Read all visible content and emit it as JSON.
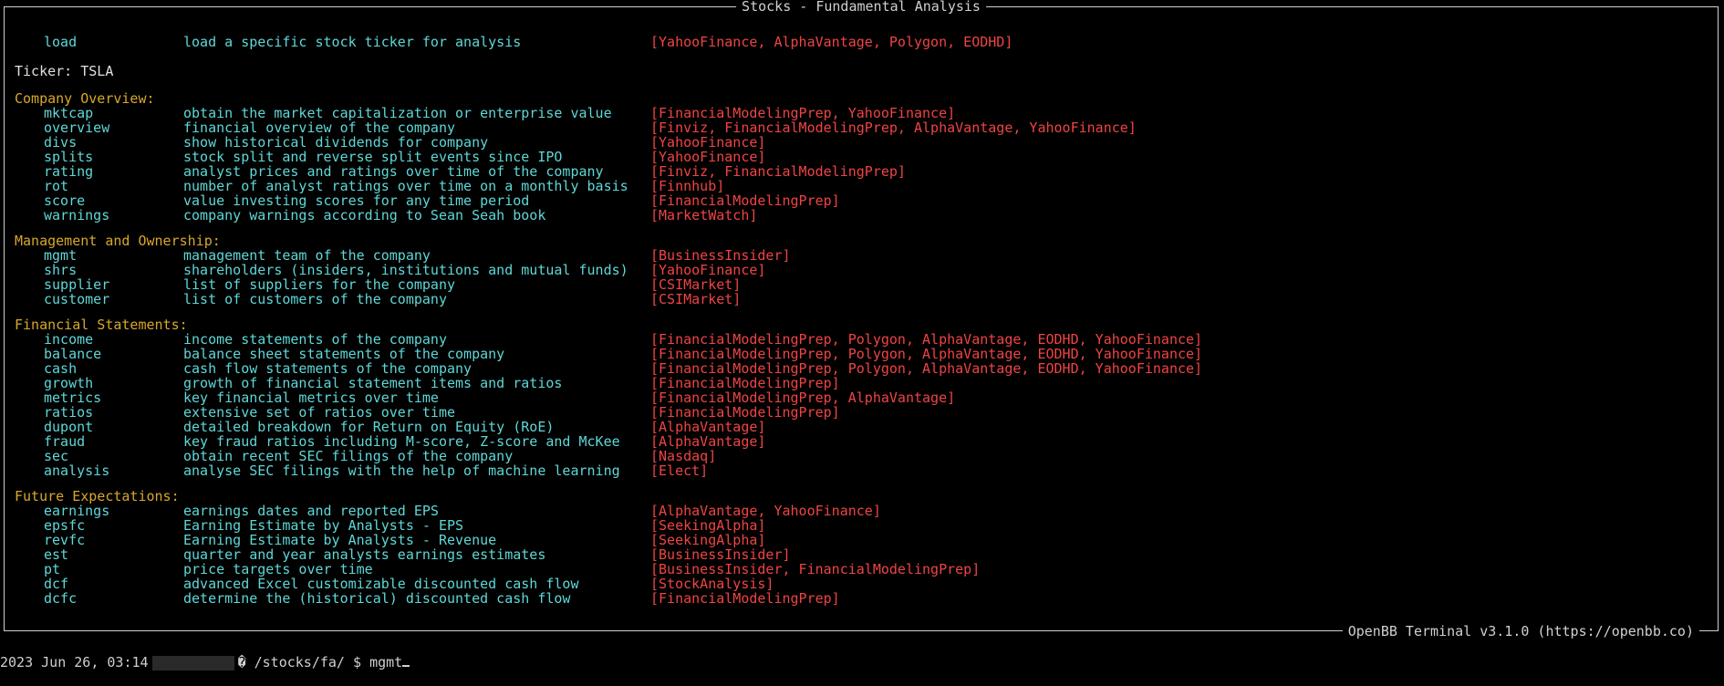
{
  "window": {
    "title": "Stocks - Fundamental Analysis",
    "footer": "OpenBB Terminal v3.1.0 (https://openbb.co)"
  },
  "load": {
    "cmd": "load",
    "desc": "load a specific stock ticker for analysis",
    "src": "[YahooFinance, AlphaVantage, Polygon, EODHD]"
  },
  "ticker": "Ticker: TSLA",
  "sections": [
    {
      "title": "Company Overview:",
      "items": [
        {
          "cmd": "mktcap",
          "desc": "obtain the market capitalization or enterprise value",
          "src": "[FinancialModelingPrep, YahooFinance]"
        },
        {
          "cmd": "overview",
          "desc": "financial overview of the company",
          "src": "[Finviz, FinancialModelingPrep, AlphaVantage, YahooFinance]"
        },
        {
          "cmd": "divs",
          "desc": "show historical dividends for company",
          "src": "[YahooFinance]"
        },
        {
          "cmd": "splits",
          "desc": "stock split and reverse split events since IPO",
          "src": "[YahooFinance]"
        },
        {
          "cmd": "rating",
          "desc": "analyst prices and ratings over time of the company",
          "src": "[Finviz, FinancialModelingPrep]"
        },
        {
          "cmd": "rot",
          "desc": "number of analyst ratings over time on a monthly basis",
          "src": "[Finnhub]"
        },
        {
          "cmd": "score",
          "desc": "value investing scores for any time period",
          "src": "[FinancialModelingPrep]"
        },
        {
          "cmd": "warnings",
          "desc": "company warnings according to Sean Seah book",
          "src": "[MarketWatch]"
        }
      ]
    },
    {
      "title": "Management and Ownership:",
      "items": [
        {
          "cmd": "mgmt",
          "desc": "management team of the company",
          "src": "[BusinessInsider]"
        },
        {
          "cmd": "shrs",
          "desc": "shareholders (insiders, institutions and mutual funds)",
          "src": "[YahooFinance]"
        },
        {
          "cmd": "supplier",
          "desc": "list of suppliers for the company",
          "src": "[CSIMarket]"
        },
        {
          "cmd": "customer",
          "desc": "list of customers of the company",
          "src": "[CSIMarket]"
        }
      ]
    },
    {
      "title": "Financial Statements:",
      "items": [
        {
          "cmd": "income",
          "desc": "income statements of the company",
          "src": "[FinancialModelingPrep, Polygon, AlphaVantage, EODHD, YahooFinance]"
        },
        {
          "cmd": "balance",
          "desc": "balance sheet statements of the company",
          "src": "[FinancialModelingPrep, Polygon, AlphaVantage, EODHD, YahooFinance]"
        },
        {
          "cmd": "cash",
          "desc": "cash flow statements of the company",
          "src": "[FinancialModelingPrep, Polygon, AlphaVantage, EODHD, YahooFinance]"
        },
        {
          "cmd": "growth",
          "desc": "growth of financial statement items and ratios",
          "src": "[FinancialModelingPrep]"
        },
        {
          "cmd": "metrics",
          "desc": "key financial metrics over time",
          "src": "[FinancialModelingPrep, AlphaVantage]"
        },
        {
          "cmd": "ratios",
          "desc": "extensive set of ratios over time",
          "src": "[FinancialModelingPrep]"
        },
        {
          "cmd": "dupont",
          "desc": "detailed breakdown for Return on Equity (RoE)",
          "src": "[AlphaVantage]"
        },
        {
          "cmd": "fraud",
          "desc": "key fraud ratios including M-score, Z-score and McKee",
          "src": "[AlphaVantage]"
        },
        {
          "cmd": "sec",
          "desc": "obtain recent SEC filings of the company",
          "src": "[Nasdaq]"
        },
        {
          "cmd": "analysis",
          "desc": "analyse SEC filings with the help of machine learning",
          "src": "[Elect]"
        }
      ]
    },
    {
      "title": "Future Expectations:",
      "items": [
        {
          "cmd": "earnings",
          "desc": "earnings dates and reported EPS",
          "src": "[AlphaVantage, YahooFinance]"
        },
        {
          "cmd": "epsfc",
          "desc": "Earning Estimate by Analysts - EPS",
          "src": "[SeekingAlpha]"
        },
        {
          "cmd": "revfc",
          "desc": "Earning Estimate by Analysts - Revenue",
          "src": "[SeekingAlpha]"
        },
        {
          "cmd": "est",
          "desc": "quarter and year analysts earnings estimates",
          "src": "[BusinessInsider]"
        },
        {
          "cmd": "pt",
          "desc": "price targets over time",
          "src": "[BusinessInsider, FinancialModelingPrep]"
        },
        {
          "cmd": "dcf",
          "desc": "advanced Excel customizable discounted cash flow",
          "src": "[StockAnalysis]"
        },
        {
          "cmd": "dcfc",
          "desc": "determine the (historical) discounted cash flow",
          "src": "[FinancialModelingPrep]"
        }
      ]
    }
  ],
  "prompt": {
    "timestamp": "2023 Jun 26, 03:14",
    "path": "� /stocks/fa/ $",
    "input": "mgmt"
  },
  "colors": {
    "command": "#5fd7d7",
    "source": "#ef4444",
    "section": "#d7a82a",
    "text": "#d0d0d0"
  }
}
